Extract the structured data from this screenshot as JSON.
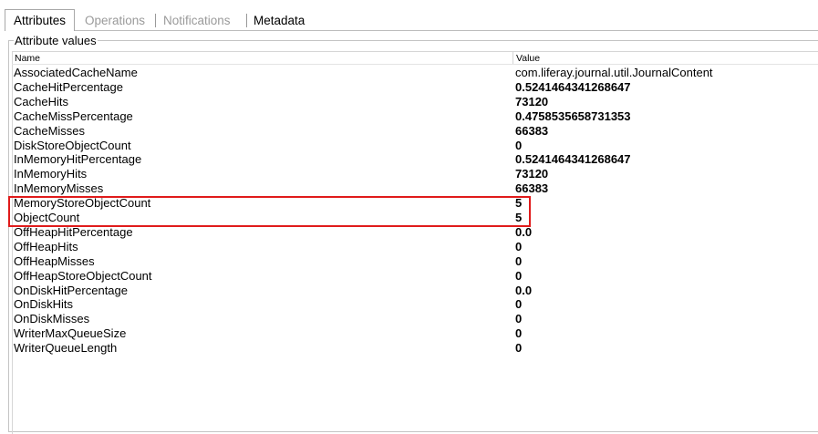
{
  "tabs": [
    {
      "label": "Attributes",
      "state": "selected"
    },
    {
      "label": "Operations",
      "state": "disabled"
    },
    {
      "label": "Notifications",
      "state": "disabled"
    },
    {
      "label": "Metadata",
      "state": "enabled"
    }
  ],
  "group": {
    "title": "Attribute values"
  },
  "table": {
    "columns": [
      "Name",
      "Value"
    ],
    "rows": [
      {
        "name": "AssociatedCacheName",
        "value": "com.liferay.journal.util.JournalContent"
      },
      {
        "name": "CacheHitPercentage",
        "value": "0.5241464341268647"
      },
      {
        "name": "CacheHits",
        "value": "73120"
      },
      {
        "name": "CacheMissPercentage",
        "value": "0.4758535658731353"
      },
      {
        "name": "CacheMisses",
        "value": "66383"
      },
      {
        "name": "DiskStoreObjectCount",
        "value": "0"
      },
      {
        "name": "InMemoryHitPercentage",
        "value": "0.5241464341268647"
      },
      {
        "name": "InMemoryHits",
        "value": "73120"
      },
      {
        "name": "InMemoryMisses",
        "value": "66383"
      },
      {
        "name": "MemoryStoreObjectCount",
        "value": "5"
      },
      {
        "name": "ObjectCount",
        "value": "5"
      },
      {
        "name": "OffHeapHitPercentage",
        "value": "0.0"
      },
      {
        "name": "OffHeapHits",
        "value": "0"
      },
      {
        "name": "OffHeapMisses",
        "value": "0"
      },
      {
        "name": "OffHeapStoreObjectCount",
        "value": "0"
      },
      {
        "name": "OnDiskHitPercentage",
        "value": "0.0"
      },
      {
        "name": "OnDiskHits",
        "value": "0"
      },
      {
        "name": "OnDiskMisses",
        "value": "0"
      },
      {
        "name": "WriterMaxQueueSize",
        "value": "0"
      },
      {
        "name": "WriterQueueLength",
        "value": "0"
      }
    ]
  },
  "highlight": {
    "color": "#e01b1b",
    "rows": [
      "MemoryStoreObjectCount",
      "ObjectCount"
    ]
  }
}
